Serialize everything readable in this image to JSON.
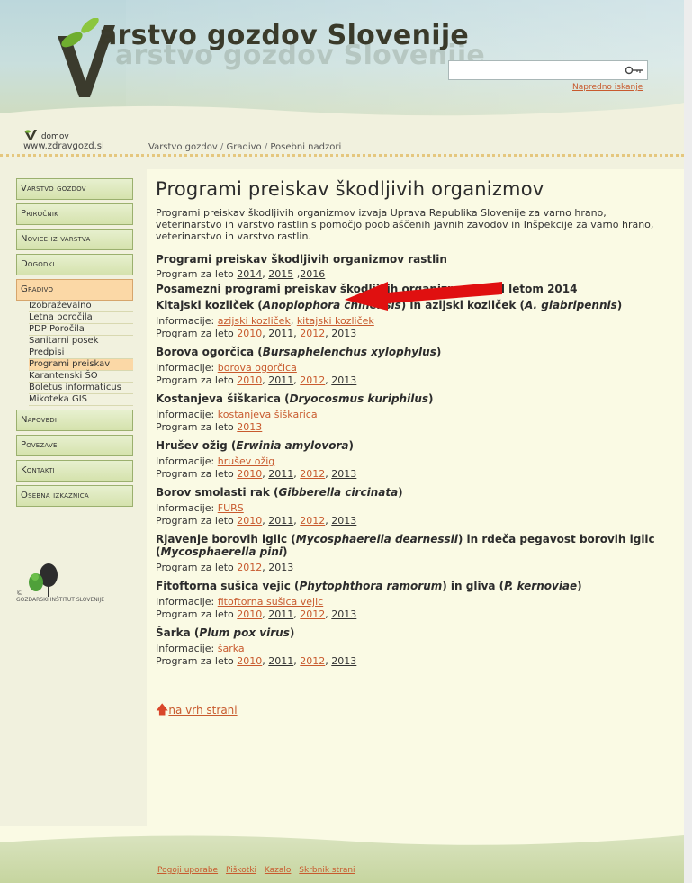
{
  "header": {
    "site_title": "arstvo gozdov Slovenije",
    "search_placeholder": "",
    "advanced_search": "Napredno iskanje"
  },
  "home": {
    "label": "domov",
    "url": "www.zdravgozd.si"
  },
  "breadcrumb": [
    "Varstvo gozdov",
    "Gradivo",
    "Posebni nadzori"
  ],
  "sidebar": {
    "items": [
      {
        "label": "Varstvo gozdov"
      },
      {
        "label": "Priročnik"
      },
      {
        "label": "Novice iz varstva"
      },
      {
        "label": "Dogodki"
      },
      {
        "label": "Gradivo"
      },
      {
        "label": "Napovedi"
      },
      {
        "label": "Povezave"
      },
      {
        "label": "Kontakti"
      },
      {
        "label": "Osebna izkaznica"
      }
    ],
    "submenu": [
      "Izobraževalno",
      "Letna poročila",
      "PDP Poročila",
      "Sanitarni posek",
      "Predpisi",
      "Programi preiskav",
      "Karantenski ŠO",
      "Boletus informaticus",
      "Mikoteka GIS"
    ]
  },
  "fgis": {
    "copyright": "©",
    "name": "GOZDARSKI INŠTITUT SLOVENIJE"
  },
  "main": {
    "title": "Programi preiskav škodljivih organizmov",
    "intro": "Programi preiskav škodljivih organizmov izvaja Uprava Republika Slovenije za varno hrano, veterinarstvo in varstvo rastlin s pomočjo pooblaščenih javnih zavodov in Inšpekcije za varno hrano, veterinarstvo in varstvo rastlin.",
    "sec1_title": "Programi preiskav škodljivih organizmov rastlin",
    "program_label": "Program za leto",
    "sec1_years": [
      "2014",
      "2015",
      "2016"
    ],
    "sec2_title": "Posamezni programi preiskav škodljivih organizmov pred letom 2014",
    "info_label": "Informacije:",
    "pests": [
      {
        "name": "Kitajski kozliček (",
        "latin": "Anoplophora chinensis",
        "mid": ") in azijski kozliček (",
        "latin2": "A. glabripennis",
        "end": ")",
        "info": [
          "azijski kozliček",
          "kitajski kozliček"
        ],
        "years": [
          "2010",
          "2011",
          "2012",
          "2013"
        ]
      },
      {
        "name": "Borova ogorčica (",
        "latin": "Bursaphelenchus xylophylus",
        "end": ")",
        "info": [
          "borova ogorčica"
        ],
        "years": [
          "2010",
          "2011",
          "2012",
          "2013"
        ]
      },
      {
        "name": "Kostanjeva šiškarica (",
        "latin": "Dryocosmus kuriphilus",
        "end": ")",
        "info": [
          "kostanjeva šiškarica"
        ],
        "years": [
          "2013"
        ]
      },
      {
        "name": "Hrušev ožig (",
        "latin": "Erwinia amylovora",
        "end": ")",
        "info": [
          "hrušev ožig"
        ],
        "years": [
          "2010",
          "2011",
          "2012",
          "2013"
        ]
      },
      {
        "name": "Borov smolasti rak (",
        "latin": "Gibberella circinata",
        "end": ")",
        "info": [
          "FURS"
        ],
        "years": [
          "2010",
          "2011",
          "2012",
          "2013"
        ]
      },
      {
        "name": "Rjavenje borovih iglic (",
        "latin": "Mycosphaerella dearnessii",
        "mid": ") in rdeča pegavost borovih iglic (",
        "latin2": "Mycosphaerella pini",
        "end": ")",
        "info": [],
        "years": [
          "2012",
          "2013"
        ]
      },
      {
        "name": "Fitoftorna sušica vejic (",
        "latin": "Phytophthora ramorum",
        "mid": ") in gliva (",
        "latin2": "P. kernoviae",
        "end": ")",
        "info": [
          "fitoftorna sušica vejic"
        ],
        "years": [
          "2010",
          "2011",
          "2012",
          "2013"
        ]
      },
      {
        "name": "Šarka (",
        "latin": "Plum pox virus",
        "end": ")",
        "info": [
          "šarka"
        ],
        "years": [
          "2010",
          "2011",
          "2012",
          "2013"
        ]
      }
    ],
    "back_to_top": "na vrh strani"
  },
  "footer": {
    "links": [
      "Pogoji uporabe",
      "Piškotki",
      "Kazalo",
      "Skrbnik strani"
    ]
  },
  "colors": {
    "link": "#c85a2e",
    "nav_bg": "#d5e2ad",
    "nav_active": "#fbd8a6",
    "annotation_arrow": "#e01010"
  }
}
